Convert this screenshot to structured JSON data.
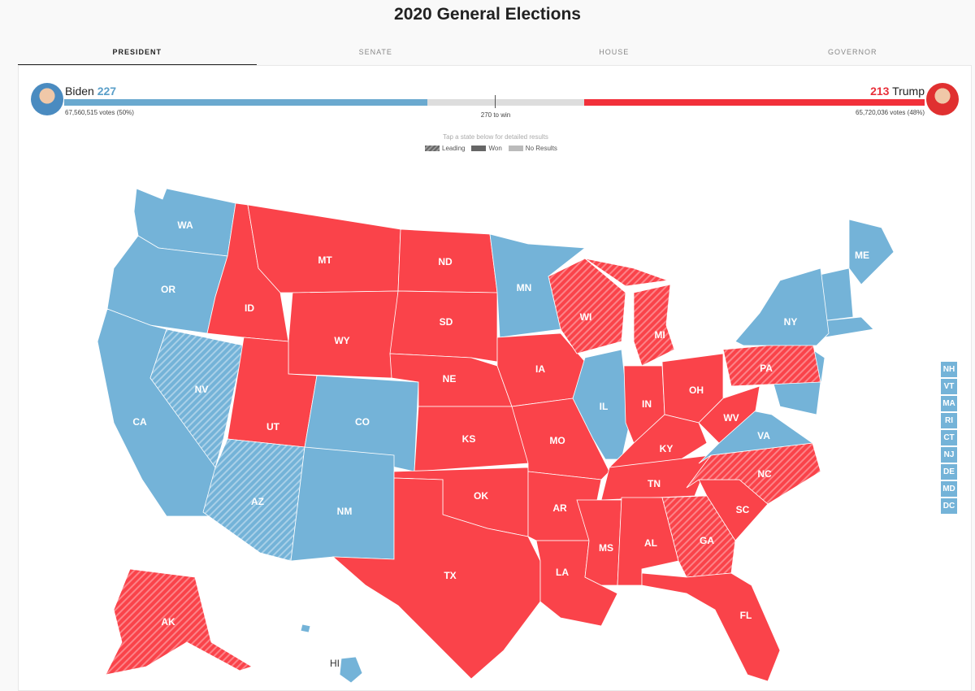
{
  "title": "2020 General Elections",
  "tabs": [
    {
      "label": "PRESIDENT",
      "active": true
    },
    {
      "label": "SENATE"
    },
    {
      "label": "HOUSE"
    },
    {
      "label": "GOVERNOR"
    }
  ],
  "biden": {
    "name": "Biden",
    "ev": "227",
    "votes": "67,560,515 votes (50%)",
    "ev_value": 227,
    "color": "#5a9fc9"
  },
  "trump": {
    "name": "Trump",
    "ev": "213",
    "votes": "65,720,036 votes (48%)",
    "ev_value": 213,
    "color": "#e8303a"
  },
  "total_ev": 538,
  "to_win": "270 to win",
  "hint": "Tap a state below for detailed results",
  "legend": [
    "Leading",
    "Won",
    "No Results"
  ],
  "colors": {
    "dem": "#74b3d8",
    "rep": "#fa434a"
  },
  "states": [
    {
      "abbr": "WA",
      "party": "dem",
      "status": "won"
    },
    {
      "abbr": "OR",
      "party": "dem",
      "status": "won"
    },
    {
      "abbr": "CA",
      "party": "dem",
      "status": "won"
    },
    {
      "abbr": "NV",
      "party": "dem",
      "status": "leading"
    },
    {
      "abbr": "ID",
      "party": "rep",
      "status": "won"
    },
    {
      "abbr": "MT",
      "party": "rep",
      "status": "won"
    },
    {
      "abbr": "WY",
      "party": "rep",
      "status": "won"
    },
    {
      "abbr": "UT",
      "party": "rep",
      "status": "won"
    },
    {
      "abbr": "AZ",
      "party": "dem",
      "status": "leading"
    },
    {
      "abbr": "CO",
      "party": "dem",
      "status": "won"
    },
    {
      "abbr": "NM",
      "party": "dem",
      "status": "won"
    },
    {
      "abbr": "ND",
      "party": "rep",
      "status": "won"
    },
    {
      "abbr": "SD",
      "party": "rep",
      "status": "won"
    },
    {
      "abbr": "NE",
      "party": "rep",
      "status": "won"
    },
    {
      "abbr": "KS",
      "party": "rep",
      "status": "won"
    },
    {
      "abbr": "OK",
      "party": "rep",
      "status": "won"
    },
    {
      "abbr": "TX",
      "party": "rep",
      "status": "won"
    },
    {
      "abbr": "MN",
      "party": "dem",
      "status": "won"
    },
    {
      "abbr": "IA",
      "party": "rep",
      "status": "won"
    },
    {
      "abbr": "MO",
      "party": "rep",
      "status": "won"
    },
    {
      "abbr": "AR",
      "party": "rep",
      "status": "won"
    },
    {
      "abbr": "LA",
      "party": "rep",
      "status": "won"
    },
    {
      "abbr": "WI",
      "party": "rep",
      "status": "leading"
    },
    {
      "abbr": "IL",
      "party": "dem",
      "status": "won"
    },
    {
      "abbr": "MI",
      "party": "rep",
      "status": "leading"
    },
    {
      "abbr": "IN",
      "party": "rep",
      "status": "won"
    },
    {
      "abbr": "OH",
      "party": "rep",
      "status": "won"
    },
    {
      "abbr": "KY",
      "party": "rep",
      "status": "won"
    },
    {
      "abbr": "TN",
      "party": "rep",
      "status": "won"
    },
    {
      "abbr": "MS",
      "party": "rep",
      "status": "won"
    },
    {
      "abbr": "AL",
      "party": "rep",
      "status": "won"
    },
    {
      "abbr": "GA",
      "party": "rep",
      "status": "leading"
    },
    {
      "abbr": "FL",
      "party": "rep",
      "status": "won"
    },
    {
      "abbr": "SC",
      "party": "rep",
      "status": "won"
    },
    {
      "abbr": "NC",
      "party": "rep",
      "status": "leading"
    },
    {
      "abbr": "VA",
      "party": "dem",
      "status": "won"
    },
    {
      "abbr": "WV",
      "party": "rep",
      "status": "won"
    },
    {
      "abbr": "PA",
      "party": "rep",
      "status": "leading"
    },
    {
      "abbr": "NY",
      "party": "dem",
      "status": "won"
    },
    {
      "abbr": "ME",
      "party": "dem",
      "status": "won"
    },
    {
      "abbr": "AK",
      "party": "rep",
      "status": "leading"
    },
    {
      "abbr": "HI",
      "party": "dem",
      "status": "won"
    }
  ],
  "small_states": [
    "NH",
    "VT",
    "MA",
    "RI",
    "CT",
    "NJ",
    "DE",
    "MD",
    "DC"
  ]
}
